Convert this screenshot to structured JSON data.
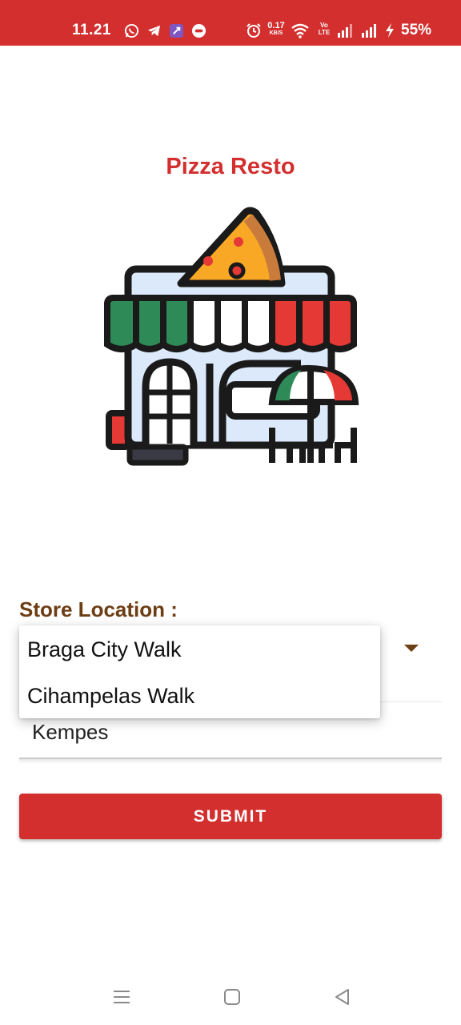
{
  "status_bar": {
    "time": "11.21",
    "net_speed_value": "0.17",
    "net_speed_unit": "KB/S",
    "volte_label": "Vo LTE",
    "battery": "55%",
    "icons": [
      "whatsapp-icon",
      "telegram-icon",
      "app-icon",
      "chat-icon",
      "alarm-icon",
      "wifi-icon",
      "signal-icon",
      "signal-icon",
      "charging-icon"
    ]
  },
  "app": {
    "title": "Pizza Resto",
    "illustration": "pizza-shop-icon"
  },
  "form": {
    "store_location_label": "Store Location :",
    "dropdown_options": [
      "Braga City Walk",
      "Cihampelas Walk"
    ],
    "name_value": "Kempes",
    "submit_label": "SUBMIT"
  },
  "nav_bar": {
    "icons": [
      "menu-icon",
      "home-icon",
      "back-icon"
    ]
  },
  "colors": {
    "primary": "#d32f2f",
    "label_brown": "#6d3d14",
    "awning_green": "#2e8b57",
    "awning_red": "#e53935"
  }
}
